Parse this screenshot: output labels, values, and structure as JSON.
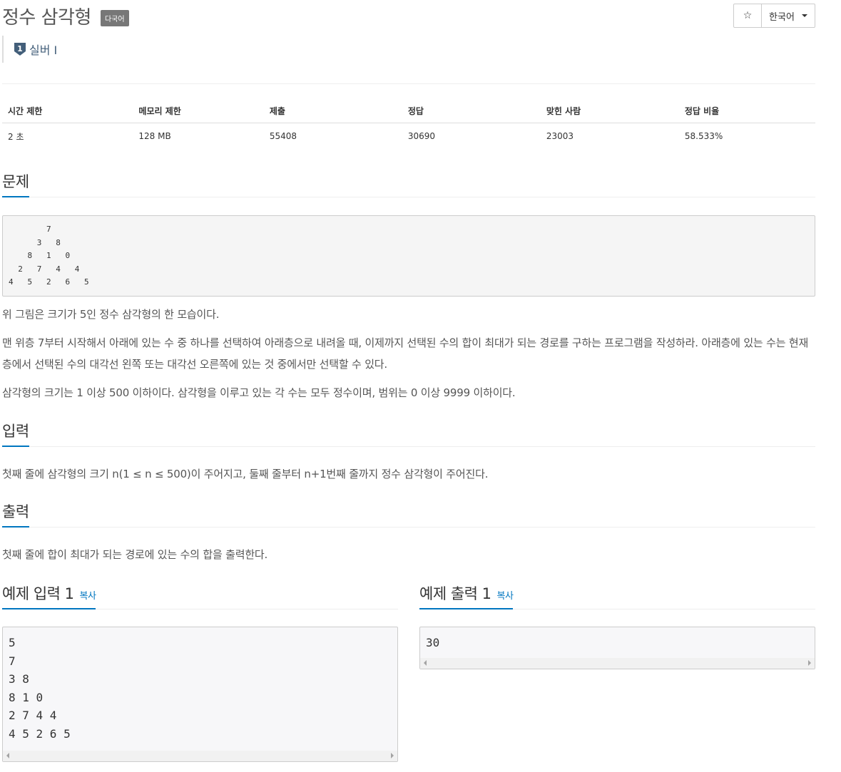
{
  "problem": {
    "title": "정수 삼각형",
    "multilang_badge": "다국어",
    "tier_number": "1",
    "tier_label": "실버 I"
  },
  "toolbar": {
    "star_icon": "☆",
    "language": "한국어"
  },
  "info_table": {
    "headers": [
      "시간 제한",
      "메모리 제한",
      "제출",
      "정답",
      "맞힌 사람",
      "정답 비율"
    ],
    "values": [
      "2 초",
      "128 MB",
      "55408",
      "30690",
      "23003",
      "58.533%"
    ]
  },
  "sections": {
    "problem": {
      "heading": "문제",
      "triangle": "        7\n      3   8\n    8   1   0\n  2   7   4   4\n4   5   2   6   5",
      "p1": "위 그림은 크기가 5인 정수 삼각형의 한 모습이다.",
      "p2": "맨 위층 7부터 시작해서 아래에 있는 수 중 하나를 선택하여 아래층으로 내려올 때, 이제까지 선택된 수의 합이 최대가 되는 경로를 구하는 프로그램을 작성하라. 아래층에 있는 수는 현재 층에서 선택된 수의 대각선 왼쪽 또는 대각선 오른쪽에 있는 것 중에서만 선택할 수 있다.",
      "p3": "삼각형의 크기는 1 이상 500 이하이다. 삼각형을 이루고 있는 각 수는 모두 정수이며, 범위는 0 이상 9999 이하이다."
    },
    "input": {
      "heading": "입력",
      "text": "첫째 줄에 삼각형의 크기 n(1 ≤ n ≤ 500)이 주어지고, 둘째 줄부터 n+1번째 줄까지 정수 삼각형이 주어진다."
    },
    "output": {
      "heading": "출력",
      "text": "첫째 줄에 합이 최대가 되는 경로에 있는 수의 합을 출력한다."
    },
    "sample_input": {
      "heading": "예제 입력 1",
      "copy": "복사",
      "content": "5\n7\n3 8\n8 1 0\n2 7 4 4\n4 5 2 6 5"
    },
    "sample_output": {
      "heading": "예제 출력 1",
      "copy": "복사",
      "content": "30"
    }
  }
}
